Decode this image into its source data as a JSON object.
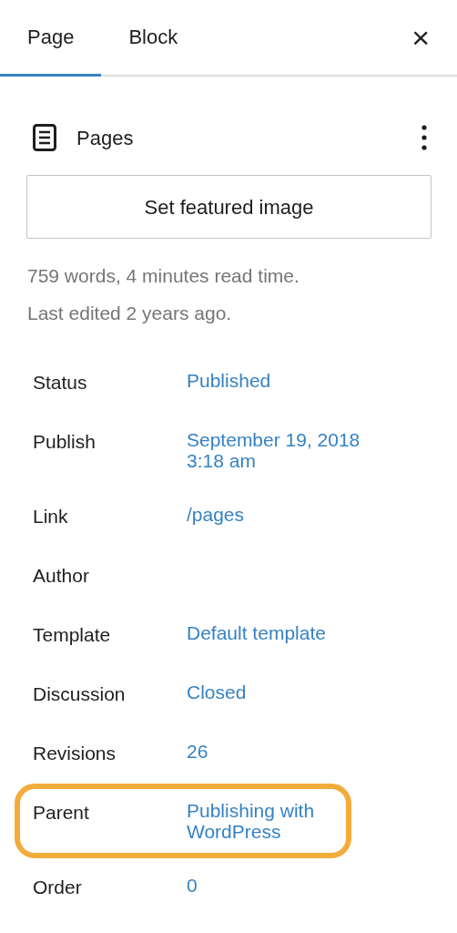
{
  "tabs": [
    {
      "label": "Page",
      "selected": true
    },
    {
      "label": "Block",
      "selected": false
    }
  ],
  "close": {
    "label": "×"
  },
  "summary": {
    "title": "Pages"
  },
  "featured_button": {
    "label": "Set featured image"
  },
  "stats": [
    "759 words, 4 minutes read time.",
    "Last edited 2 years ago."
  ],
  "fields": [
    {
      "label": "Status",
      "value": "Published",
      "highlighted": false
    },
    {
      "label": "Publish",
      "value": "September 19, 2018 3:18 am",
      "highlighted": false
    },
    {
      "label": "Link",
      "value": "/pages",
      "highlighted": false
    },
    {
      "label": "Author",
      "highlighted": false
    },
    {
      "label": "Template",
      "value": "Default template",
      "highlighted": false
    },
    {
      "label": "Discussion",
      "value": "Closed",
      "highlighted": false
    },
    {
      "label": "Revisions",
      "value": "26",
      "highlighted": false
    },
    {
      "label": "Parent",
      "value": "Publishing with WordPress",
      "highlighted": true
    },
    {
      "label": "Order",
      "value": "0",
      "highlighted": false
    }
  ]
}
